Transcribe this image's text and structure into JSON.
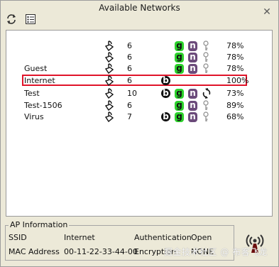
{
  "window": {
    "title": "Available Networks"
  },
  "colors": {
    "highlight_border": "#e0142a",
    "badge_g": "#2cd12c",
    "badge_n": "#6b4a7a",
    "badge_b": "#111111"
  },
  "toolbar": {
    "refresh_icon": "refresh-icon",
    "details_icon": "list-view-icon"
  },
  "networks": [
    {
      "name": "",
      "channel": "6",
      "b": false,
      "g": true,
      "n": true,
      "key": "key-icon",
      "percent": "78%",
      "selected": false
    },
    {
      "name": "",
      "channel": "6",
      "b": false,
      "g": true,
      "n": true,
      "key": "key-icon",
      "percent": "78%",
      "selected": false
    },
    {
      "name": "Guest",
      "channel": "6",
      "b": false,
      "g": true,
      "n": true,
      "key": "key-icon",
      "percent": "78%",
      "selected": false
    },
    {
      "name": "Internet",
      "channel": "6",
      "b": true,
      "g": false,
      "n": false,
      "key": "",
      "percent": "100%",
      "selected": true
    },
    {
      "name": "Test",
      "channel": "10",
      "b": true,
      "g": true,
      "n": true,
      "key": "connect-icon",
      "percent": "73%",
      "selected": false
    },
    {
      "name": "Test-1506",
      "channel": "6",
      "b": false,
      "g": true,
      "n": true,
      "key": "key-icon",
      "percent": "89%",
      "selected": false
    },
    {
      "name": "Virus",
      "channel": "7",
      "b": true,
      "g": true,
      "n": true,
      "key": "key-icon",
      "percent": "68%",
      "selected": false
    }
  ],
  "badges": {
    "b": "b",
    "g": "g",
    "n": "n"
  },
  "ap_info": {
    "title": "AP Information",
    "ssid_label": "SSID",
    "ssid_value": "Internet",
    "auth_label": "Authentication",
    "auth_value": "Open",
    "mac_label": "MAC Address",
    "mac_value": "00-11-22-33-44-00",
    "enc_label": "Encryption",
    "enc_value": "NONE"
  },
  "watermark": "掘金技术社区 @ 布客飞龙"
}
